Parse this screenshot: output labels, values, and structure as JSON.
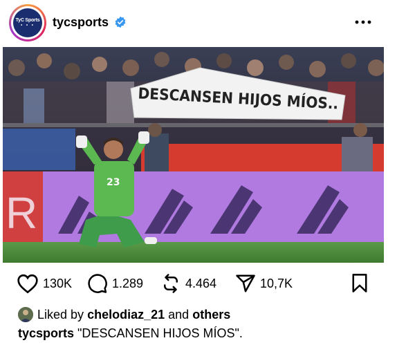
{
  "post": {
    "username": "tycsports",
    "avatar_text": "TyC Sports",
    "avatar_dots": "• • •",
    "icons": {
      "verified": "verified-badge-icon",
      "more": "more-options-icon",
      "like": "heart-icon",
      "comment": "comment-icon",
      "repost": "repost-icon",
      "share": "send-icon",
      "save": "bookmark-icon"
    },
    "photo": {
      "banner_text": "DESCANSEN HIJOS MÍOS..",
      "jersey_number": "23",
      "ad_letter": "R"
    },
    "stats": {
      "likes": "130K",
      "comments": "1.289",
      "reposts": "4.464",
      "shares": "10,7K"
    },
    "liked_by": {
      "prefix": "Liked by",
      "user": "chelodiaz_21",
      "middle": "and",
      "others": "others"
    },
    "caption": {
      "user": "tycsports",
      "text": "\"DESCANSEN HIJOS MÍOS\"."
    },
    "colors": {
      "verified": "#3897f0",
      "brand_blue": "#1a2d6e",
      "ad_purple": "#b07ae0",
      "pitch_green": "#4a8a3a"
    }
  }
}
